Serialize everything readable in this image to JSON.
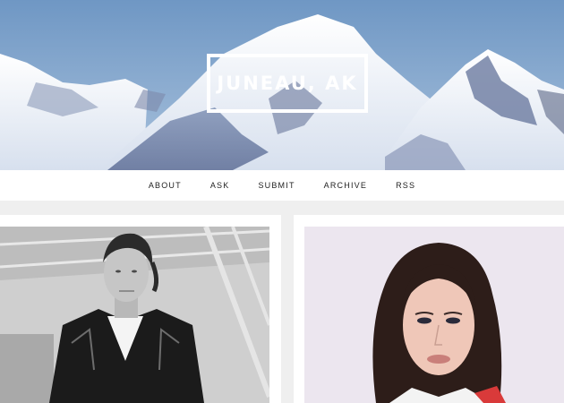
{
  "blog": {
    "title": "JUNEAU, AK"
  },
  "nav": {
    "items": [
      {
        "label": "ABOUT"
      },
      {
        "label": "ASK"
      },
      {
        "label": "SUBMIT"
      },
      {
        "label": "ARCHIVE"
      },
      {
        "label": "RSS"
      }
    ]
  },
  "colors": {
    "sky": "#7fa2c8",
    "snow": "#eef2f8",
    "nav_bg": "#ffffff",
    "page_bg": "#efefef"
  },
  "posts": [
    {
      "kind": "photo",
      "subject": "black-and-white portrait of man in leather jacket"
    },
    {
      "kind": "photo",
      "subject": "color portrait of woman with dark hair"
    }
  ]
}
